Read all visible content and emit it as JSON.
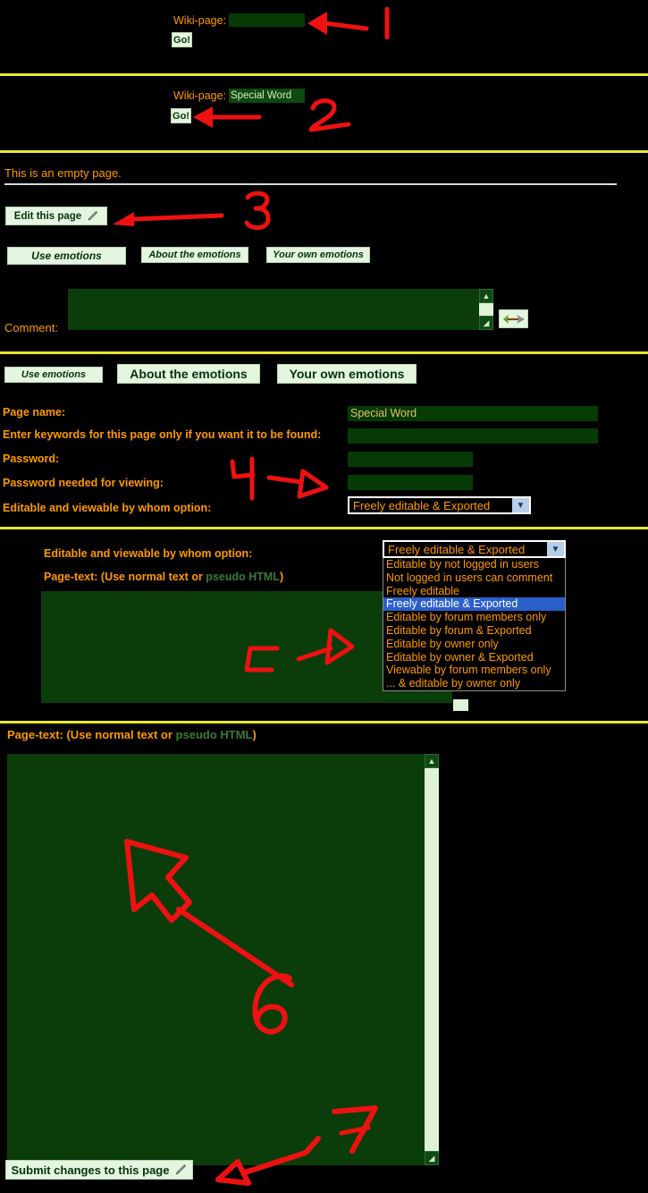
{
  "colors": {
    "background": "#000000",
    "accent_text": "#ff9900",
    "separator_yellow": "#e8e82a",
    "input_green": "#063b06",
    "button_green": "#e4f5e0",
    "textarea_green": "#0a3d0a",
    "annotation_red": "#ee1111",
    "highlight_blue": "#2a5fc9",
    "pseudo_html_green": "#3a7a3a"
  },
  "step1": {
    "wiki_label": "Wiki-page:",
    "wiki_value": "",
    "go_label": "Go!",
    "annotation": "1"
  },
  "step2": {
    "wiki_label": "Wiki-page:",
    "wiki_value": "Special Word",
    "go_label": "Go!",
    "annotation": "2"
  },
  "step3": {
    "empty_page_text": "This is an empty page.",
    "edit_button": "Edit this page",
    "edit_icon": "pencil-icon",
    "emotion_buttons": [
      "Use emotions",
      "About the emotions",
      "Your own emotions"
    ],
    "comment_label": "Comment:",
    "comment_value": "",
    "send_icon": "arrow-send-icon",
    "annotation": "3"
  },
  "step4": {
    "emotion_buttons": [
      "Use emotions",
      "About the emotions",
      "Your own emotions"
    ],
    "fields": [
      {
        "label": "Page name:",
        "value": "Special Word"
      },
      {
        "label": "Enter keywords for this page only if you want it to be found:",
        "value": ""
      },
      {
        "label": "Password:",
        "value": ""
      },
      {
        "label": "Password needed for viewing:",
        "value": ""
      }
    ],
    "select_label": "Editable and viewable by whom option:",
    "select_value": "Freely editable & Exported",
    "annotation": "4"
  },
  "step5": {
    "select_label": "Editable and viewable by whom option:",
    "select_value": "Freely editable & Exported",
    "pagetext_label_a": "Page-text: (Use normal text or ",
    "pagetext_label_b": "pseudo HTML",
    "pagetext_label_c": ")",
    "options": [
      "Editable by not logged in users",
      "Not logged in users can comment",
      "Freely editable",
      "Freely editable & Exported",
      "Editable by forum members only",
      "Editable by forum & Exported",
      "Editable by owner only",
      "Editable by owner & Exported",
      "Viewable by forum members only",
      "... & editable by owner only"
    ],
    "selected_index": 3,
    "annotation": "5"
  },
  "step6": {
    "pagetext_label_a": "Page-text: (Use normal text or ",
    "pagetext_label_b": "pseudo HTML",
    "pagetext_label_c": ")",
    "pagetext_value": "",
    "annotation": "6"
  },
  "step7": {
    "submit_label": "Submit changes to this page",
    "submit_icon": "pencil-icon",
    "annotation": "7"
  }
}
